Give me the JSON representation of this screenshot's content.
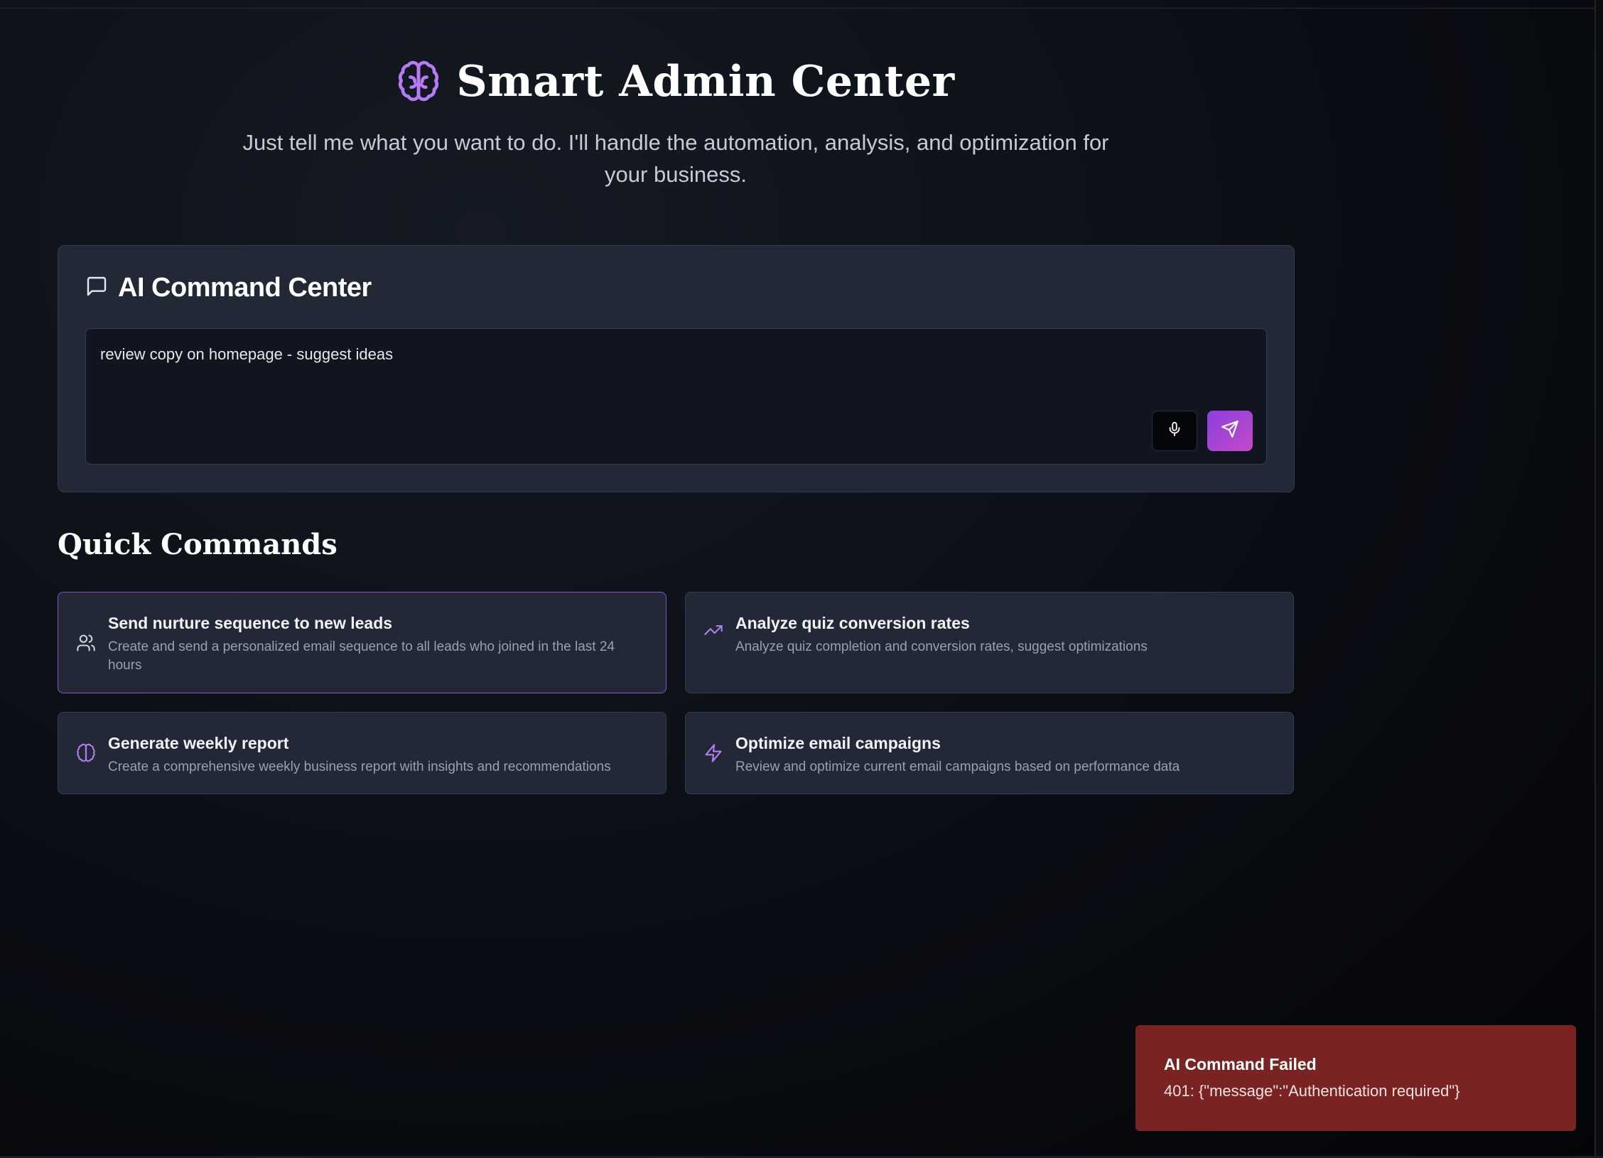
{
  "hero": {
    "title": "Smart Admin Center",
    "subtitle": "Just tell me what you want to do. I'll handle the automation, analysis, and optimization for your business."
  },
  "command_center": {
    "title": "AI Command Center",
    "input_value": "review copy on homepage - suggest ideas",
    "mic_icon": "microphone-icon",
    "send_icon": "send-icon"
  },
  "quick_commands": {
    "title": "Quick Commands",
    "items": [
      {
        "name": "Send nurture sequence to new leads",
        "description": "Create and send a personalized email sequence to all leads who joined in the last 24 hours",
        "icon": "users-icon",
        "active": true
      },
      {
        "name": "Analyze quiz conversion rates",
        "description": "Analyze quiz completion and conversion rates, suggest optimizations",
        "icon": "trending-up-icon",
        "active": false
      },
      {
        "name": "Generate weekly report",
        "description": "Create a comprehensive weekly business report with insights and recommendations",
        "icon": "brain-icon",
        "active": false
      },
      {
        "name": "Optimize email campaigns",
        "description": "Review and optimize current email campaigns based on performance data",
        "icon": "lightning-icon",
        "active": false
      }
    ]
  },
  "toast": {
    "title": "AI Command Failed",
    "message": "401: {\"message\":\"Authentication required\"}"
  },
  "colors": {
    "accent": "#a855f7",
    "toast_bg": "#7a2323",
    "card_bg": "#222835",
    "active_border": "#8057c2"
  }
}
